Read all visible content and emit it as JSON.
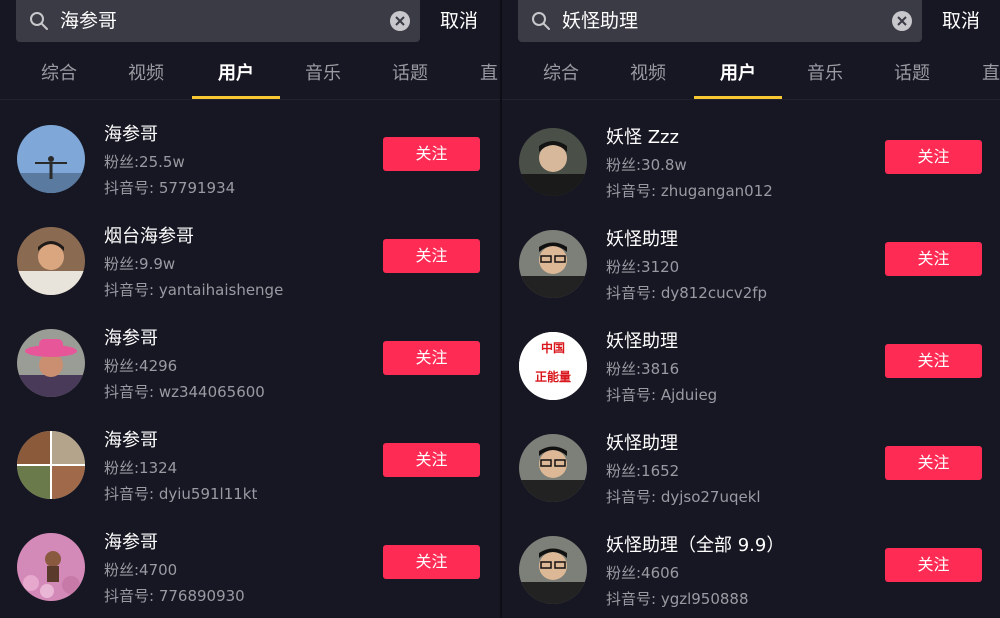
{
  "left": {
    "search": {
      "query": "海参哥",
      "cancel_label": "取消"
    },
    "tabs": [
      "综合",
      "视频",
      "用户",
      "音乐",
      "话题",
      "直"
    ],
    "active_tab": "用户",
    "users": [
      {
        "name": "海参哥",
        "fans": "粉丝:25.5w",
        "douyin_id": "抖音号: 57791934",
        "follow_label": "关注"
      },
      {
        "name": "烟台海参哥",
        "fans": "粉丝:9.9w",
        "douyin_id": "抖音号: yantaihaishenge",
        "follow_label": "关注"
      },
      {
        "name": "海参哥",
        "fans": "粉丝:4296",
        "douyin_id": "抖音号: wz344065600",
        "follow_label": "关注"
      },
      {
        "name": "海参哥",
        "fans": "粉丝:1324",
        "douyin_id": "抖音号: dyiu591l11kt",
        "follow_label": "关注"
      },
      {
        "name": "海参哥",
        "fans": "粉丝:4700",
        "douyin_id": "抖音号: 776890930",
        "follow_label": "关注"
      }
    ]
  },
  "right": {
    "search": {
      "query": "妖怪助理",
      "cancel_label": "取消"
    },
    "tabs": [
      "综合",
      "视频",
      "用户",
      "音乐",
      "话题",
      "直"
    ],
    "active_tab": "用户",
    "users": [
      {
        "name": "妖怪 Zzz",
        "fans": "粉丝:30.8w",
        "douyin_id": "抖音号: zhugangan012",
        "follow_label": "关注"
      },
      {
        "name": "妖怪助理",
        "fans": "粉丝:3120",
        "douyin_id": "抖音号: dy812cucv2fp",
        "follow_label": "关注"
      },
      {
        "name": "妖怪助理",
        "fans": "粉丝:3816",
        "douyin_id": "抖音号: Ajduieg",
        "follow_label": "关注",
        "avatar_text": [
          "中国",
          "正能量"
        ]
      },
      {
        "name": "妖怪助理",
        "fans": "粉丝:1652",
        "douyin_id": "抖音号: dyjso27uqekl",
        "follow_label": "关注"
      },
      {
        "name": "妖怪助理（全部 9.9）",
        "fans": "粉丝:4606",
        "douyin_id": "抖音号: ygzl950888",
        "follow_label": "关注"
      }
    ]
  },
  "colors": {
    "background": "#161722",
    "follow_button": "#fe2c55",
    "tab_indicator": "#f7c831",
    "secondary_text": "#9a9aa2"
  }
}
